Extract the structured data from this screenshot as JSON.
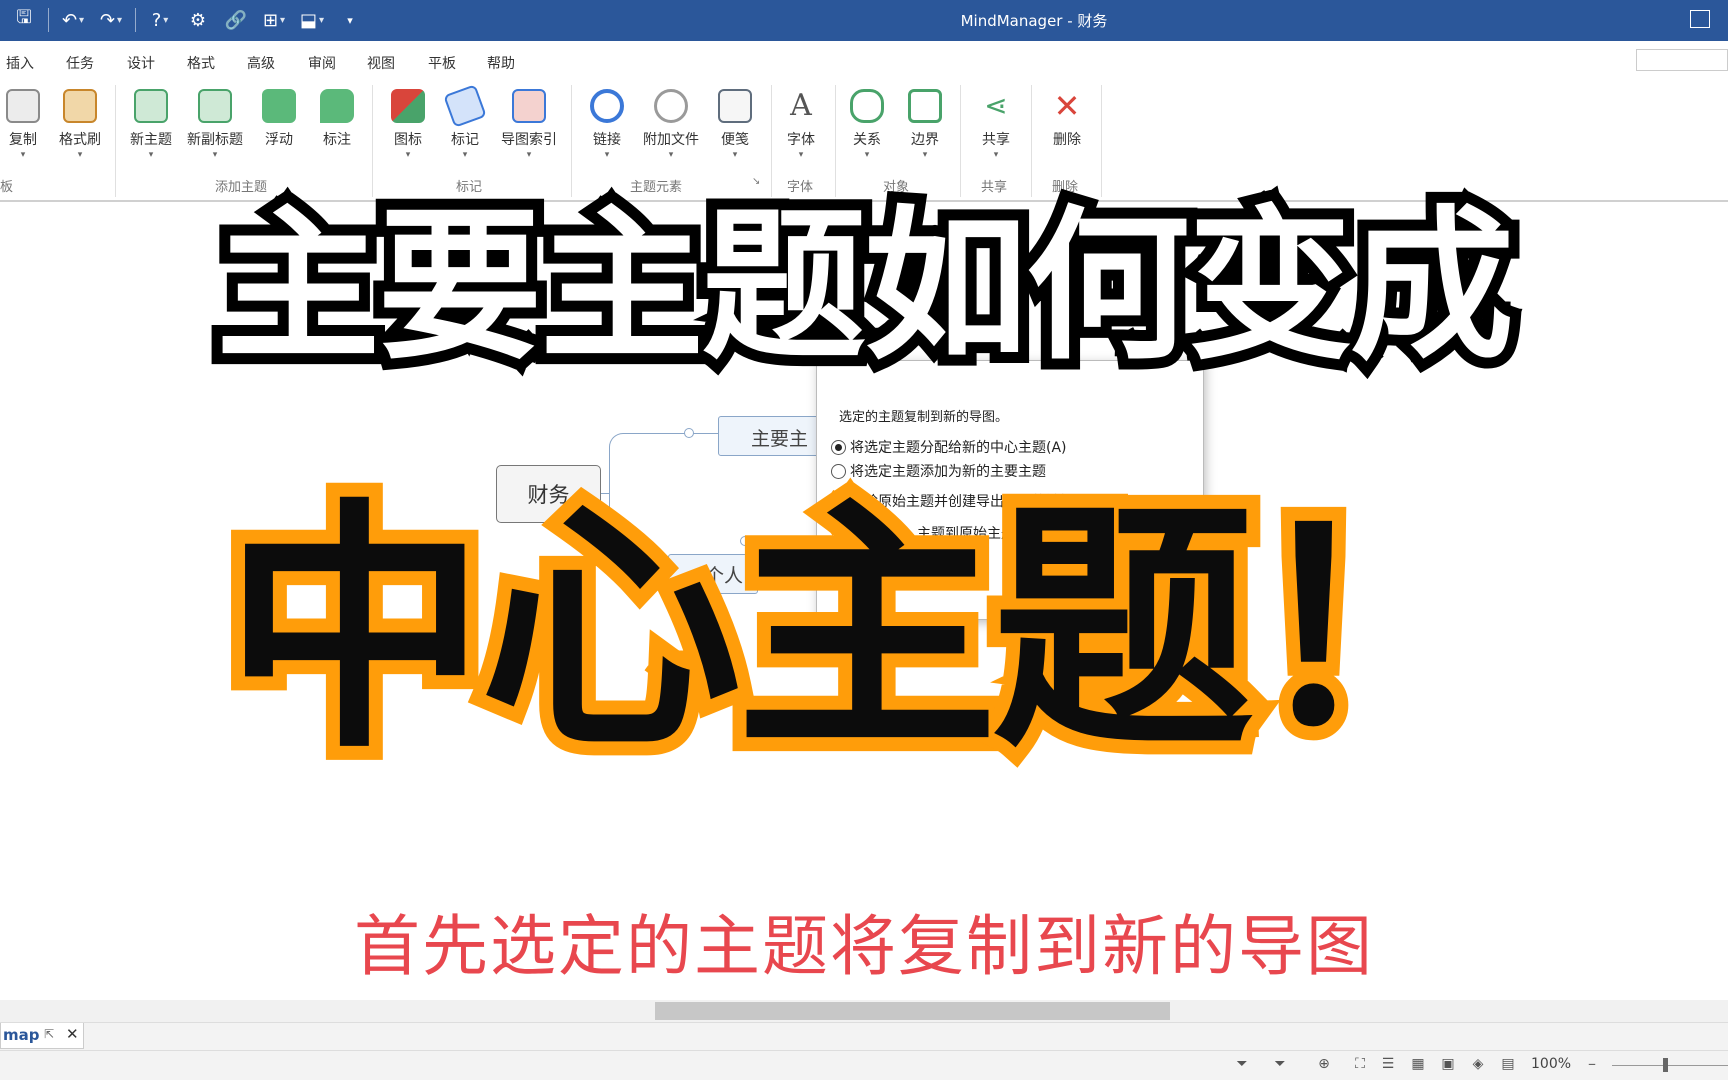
{
  "titlebar": {
    "title": "MindManager - 财务",
    "quick_icons": [
      "save-icon",
      "undo-icon",
      "redo-icon",
      "help-icon",
      "map-icon",
      "link-icon",
      "add-topic-icon",
      "share-icon",
      "customize-icon"
    ]
  },
  "menu": {
    "items": [
      "插入",
      "任务",
      "设计",
      "格式",
      "高级",
      "审阅",
      "视图",
      "平板",
      "帮助"
    ]
  },
  "ribbon": {
    "buttons": [
      {
        "label": "复制",
        "icon": "copy-icon",
        "color": "#7a7a7a"
      },
      {
        "label": "格式刷",
        "icon": "format-painter-icon",
        "color": "#c8862b"
      },
      {
        "label": "新主题",
        "icon": "new-topic-icon",
        "color": "#49a36a"
      },
      {
        "label": "新副标题",
        "icon": "new-subtopic-icon",
        "color": "#49a36a"
      },
      {
        "label": "浮动",
        "icon": "floating-topic-icon",
        "color": "#49a36a"
      },
      {
        "label": "标注",
        "icon": "callout-icon",
        "color": "#49a36a"
      },
      {
        "label": "图标",
        "icon": "icons-icon",
        "color": "#d9453b"
      },
      {
        "label": "标记",
        "icon": "tags-icon",
        "color": "#3b78d8"
      },
      {
        "label": "导图索引",
        "icon": "map-index-icon",
        "color": "#3b78d8"
      },
      {
        "label": "链接",
        "icon": "hyperlink-icon",
        "color": "#3b78d8"
      },
      {
        "label": "附加文件",
        "icon": "attach-file-icon",
        "color": "#9a9a9a"
      },
      {
        "label": "便笺",
        "icon": "notes-icon",
        "color": "#5f6d7d"
      },
      {
        "label": "字体",
        "icon": "font-icon",
        "color": "#555555"
      },
      {
        "label": "关系",
        "icon": "relationship-icon",
        "color": "#49a36a"
      },
      {
        "label": "边界",
        "icon": "boundary-icon",
        "color": "#49a36a"
      },
      {
        "label": "共享",
        "icon": "share-icon",
        "color": "#49a36a"
      },
      {
        "label": "删除",
        "icon": "delete-icon",
        "color": "#d9453b"
      }
    ],
    "groups": [
      "板",
      "添加主题",
      "标记",
      "主题元素",
      "字体",
      "对象",
      "共享",
      "删除"
    ]
  },
  "canvas": {
    "central_topic": "财务",
    "main_topic": "主要主",
    "sub_topic": "个人"
  },
  "dialog": {
    "description": "选定的主题复制到新的导图。",
    "option_assign": "将选定主题分配给新的中心主题(A)",
    "option_add": "将选定主题添加为新的主要主题",
    "check_delete": "删除原始主题并创建导出主题的链接",
    "check_link": "主题到原始主题的链"
  },
  "overlay": {
    "headline": "主要主题如何变成",
    "headline2": "中心主题！",
    "subtitle": "首先选定的主题将复制到新的导图"
  },
  "tabs": {
    "doc_tab": "map"
  },
  "statusbar": {
    "zoom": "100%",
    "icons": [
      "filter-icon",
      "filter-options-icon",
      "add-icon",
      "fit-icon",
      "outline-icon",
      "calendar-icon",
      "tasks-icon",
      "tag-icon",
      "gantt-icon"
    ]
  }
}
